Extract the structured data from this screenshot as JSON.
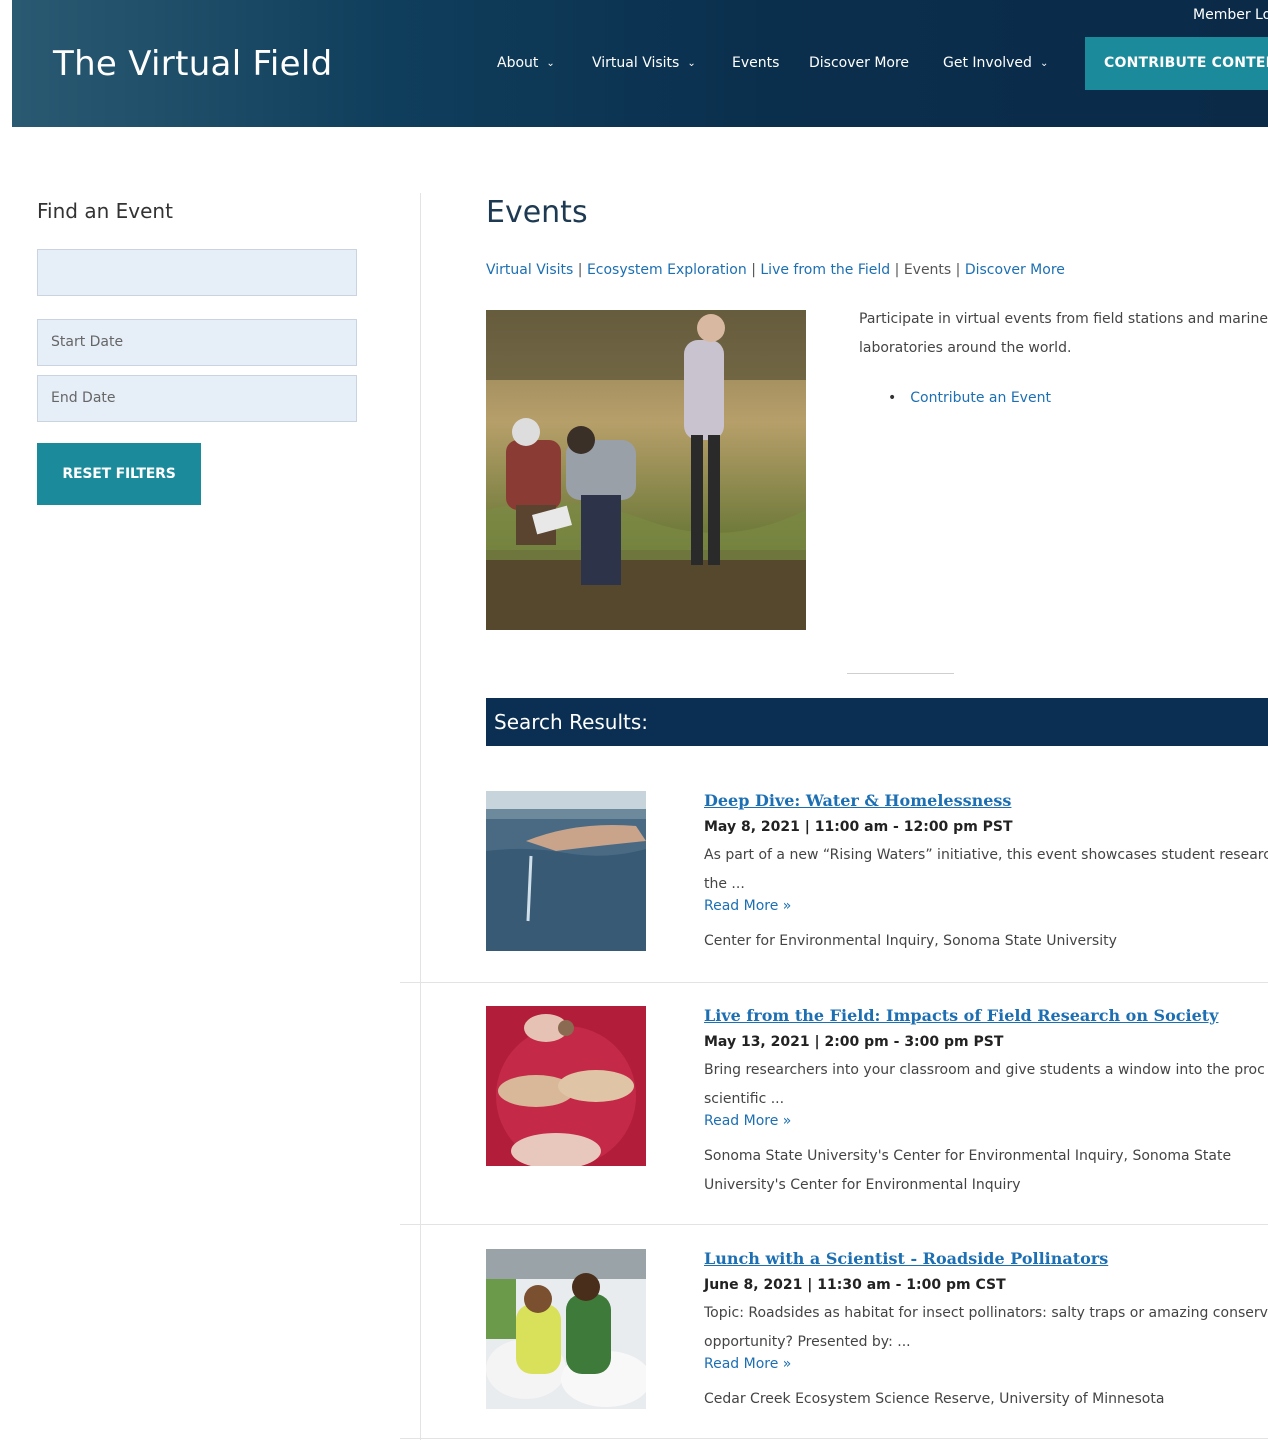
{
  "header": {
    "site_title": "The Virtual Field",
    "member_login": "Member Login",
    "nav": [
      {
        "label": "About",
        "dropdown": true
      },
      {
        "label": "Virtual Visits",
        "dropdown": true
      },
      {
        "label": "Events",
        "dropdown": false
      },
      {
        "label": "Discover More",
        "dropdown": false
      },
      {
        "label": "Get Involved",
        "dropdown": true
      }
    ],
    "contribute_button": "CONTRIBUTE CONTENT"
  },
  "sidebar": {
    "title": "Find an Event",
    "search_placeholder": "",
    "start_date_placeholder": "Start Date",
    "end_date_placeholder": "End Date",
    "reset_button": "RESET FILTERS"
  },
  "main": {
    "title": "Events",
    "breadcrumb": [
      {
        "label": "Virtual Visits",
        "link": true
      },
      {
        "label": "Ecosystem Exploration",
        "link": true
      },
      {
        "label": "Live from the Field",
        "link": true
      },
      {
        "label": "Events",
        "link": false
      },
      {
        "label": "Discover More",
        "link": true
      }
    ],
    "intro_text": "Participate in virtual events from field stations and marine laboratories around the world.",
    "contribute_link": "Contribute an Event",
    "results_heading": "Search Results:",
    "results": [
      {
        "title": "Deep Dive: Water & Homelessness",
        "date": "May 8, 2021 | 11:00 am - 12:00 pm PST",
        "description": "As part of a new “Rising Waters” initiative, this event showcases student research the ...",
        "read_more": "Read More »",
        "host": "Center for Environmental Inquiry, Sonoma State University"
      },
      {
        "title": "Live from the Field: Impacts of Field Research on Society",
        "date": "May 13, 2021 | 2:00 pm - 3:00 pm PST",
        "description": "Bring researchers into your classroom and give students a window into the proc scientific ...",
        "read_more": "Read More »",
        "host": "Sonoma State University's Center for Environmental Inquiry, Sonoma State University's Center for Environmental Inquiry"
      },
      {
        "title": "Lunch with a Scientist - Roadside Pollinators",
        "date": "June 8, 2021 | 11:30 am - 1:00 pm CST",
        "description": "Topic: Roadsides as habitat for insect pollinators: salty traps or amazing conserva opportunity? Presented by: ...",
        "read_more": "Read More »",
        "host": "Cedar Creek Ecosystem Science Reserve, University of Minnesota"
      }
    ]
  }
}
